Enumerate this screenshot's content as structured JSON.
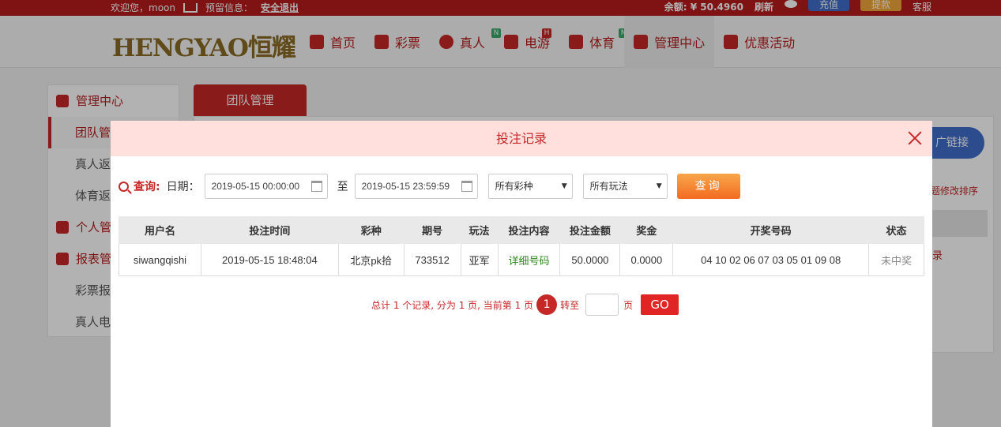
{
  "topbar": {
    "welcome": "欢迎您，moon",
    "message_label": "预留信息：",
    "logout": "安全退出",
    "balance": "余额: ¥ 50.4960",
    "refresh": "刷新",
    "deposit": "充值",
    "withdraw": "提款",
    "service": "客服"
  },
  "logo": "HENGYAO恒耀",
  "nav": {
    "items": [
      {
        "label": "首页"
      },
      {
        "label": "彩票"
      },
      {
        "label": "真人",
        "badge": "N"
      },
      {
        "label": "电游",
        "badge": "H"
      },
      {
        "label": "体育",
        "badge": "N"
      },
      {
        "label": "管理中心"
      },
      {
        "label": "优惠活动"
      }
    ]
  },
  "side": {
    "group1": "管理中心",
    "sub1": "团队管",
    "sub2": "真人返",
    "sub3": "体育返",
    "group2": "个人管",
    "group3": "报表管",
    "sub4": "彩票报",
    "sub5": "真人电"
  },
  "content": {
    "tab": "团队管理",
    "promo": "广链接",
    "sort_link": "标题修改排序",
    "right_link": "录"
  },
  "modal": {
    "title": "投注记录",
    "filter": {
      "query_label": "查询:",
      "date_label": "日期：",
      "start": "2019-05-15 00:00:00",
      "to": "至",
      "end": "2019-05-15 23:59:59",
      "lottery_select": "所有彩种",
      "play_select": "所有玩法",
      "query_button": "查询"
    },
    "table": {
      "headers": [
        "用户名",
        "投注时间",
        "彩种",
        "期号",
        "玩法",
        "投注内容",
        "投注金额",
        "奖金",
        "开奖号码",
        "状态"
      ],
      "rows": [
        [
          "siwangqishi",
          "2019-05-15 18:48:04",
          "北京pk拾",
          "733512",
          "亚军",
          "详细号码",
          "50.0000",
          "0.0000",
          "04 10 02 06 07 03 05 01 09 08",
          "未中奖"
        ]
      ]
    },
    "pager": {
      "summary": "总计 1 个记录, 分为 1 页, 当前第 1 页",
      "current": "1",
      "goto": "转至",
      "page_unit": "页",
      "go": "GO"
    }
  }
}
